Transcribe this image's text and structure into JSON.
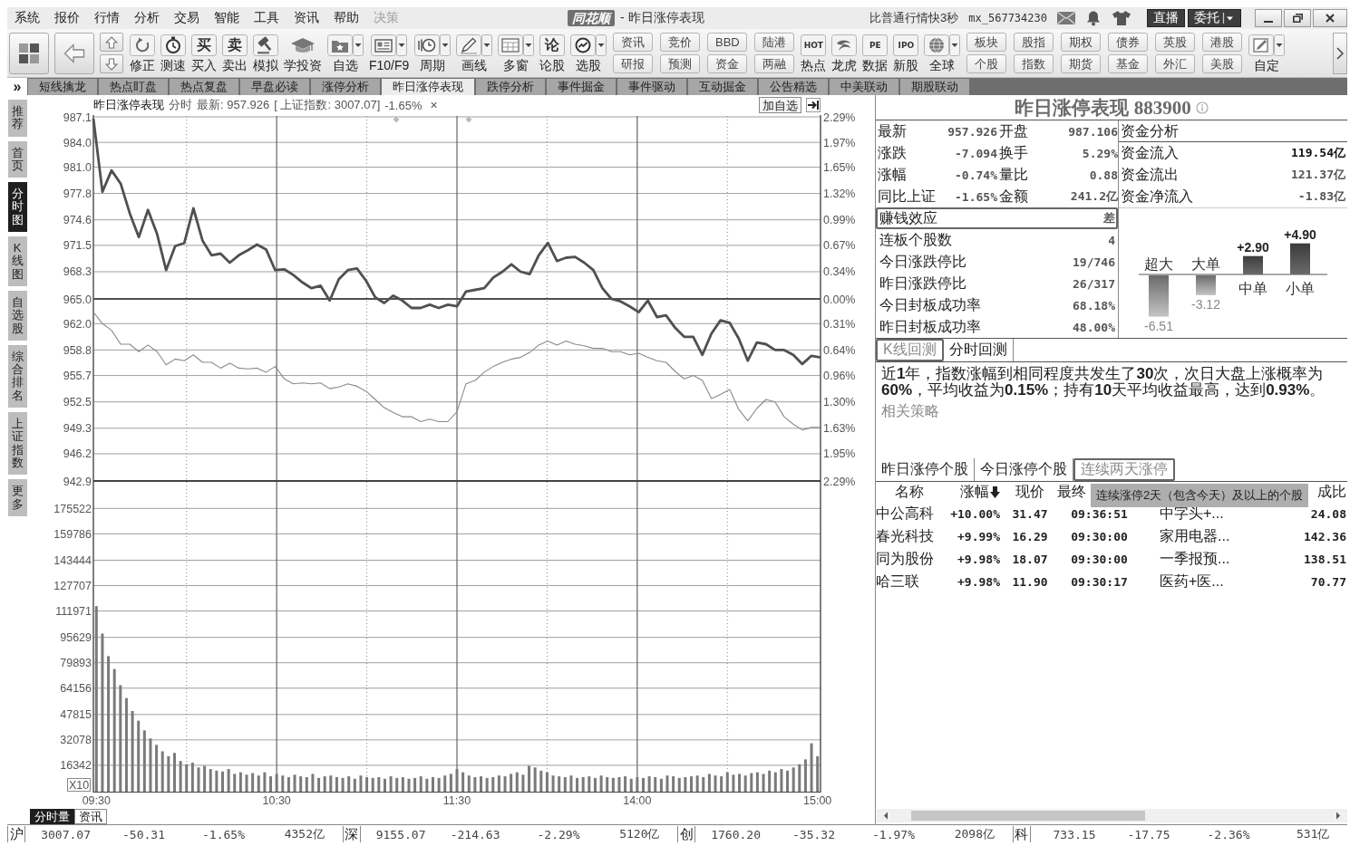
{
  "menu_bar": {
    "items": [
      {
        "label": "系统",
        "disabled": false
      },
      {
        "label": "报价",
        "disabled": false
      },
      {
        "label": "行情",
        "disabled": false
      },
      {
        "label": "分析",
        "disabled": false
      },
      {
        "label": "交易",
        "disabled": false
      },
      {
        "label": "智能",
        "disabled": false
      },
      {
        "label": "工具",
        "disabled": false
      },
      {
        "label": "资讯",
        "disabled": false
      },
      {
        "label": "帮助",
        "disabled": false
      },
      {
        "label": "决策",
        "disabled": true
      }
    ],
    "logo": "同花顺",
    "title": "- 昨日涨停表现",
    "speed_note": "比普通行情快3秒",
    "user": "mx_567734230",
    "buttons": [
      {
        "label": "直播",
        "dropdown": false
      },
      {
        "label": "委托",
        "dropdown": true
      }
    ]
  },
  "toolbar": {
    "tools": [
      {
        "label": "修正",
        "dropdown": false
      },
      {
        "label": "测速",
        "dropdown": false
      },
      {
        "label": "买入",
        "glyph": "买",
        "dropdown": false
      },
      {
        "label": "卖出",
        "glyph": "卖",
        "dropdown": false
      },
      {
        "label": "模拟",
        "dropdown": false
      },
      {
        "label": "学投资",
        "dropdown": false
      },
      {
        "label": "自选",
        "dropdown": true
      },
      {
        "label": "F10/F9",
        "dropdown": true
      },
      {
        "label": "周期",
        "dropdown": true
      },
      {
        "label": "画线",
        "dropdown": true
      },
      {
        "label": "多窗",
        "dropdown": true
      },
      {
        "label": "论股",
        "glyph": "论",
        "dropdown": false
      },
      {
        "label": "选股",
        "dropdown": true
      }
    ],
    "pairs": [
      [
        "资讯",
        "研报"
      ],
      [
        "竞价",
        "预测"
      ],
      [
        "BBD",
        "资金"
      ],
      [
        "陆港",
        "两融"
      ]
    ],
    "tools_2": [
      {
        "label": "热点",
        "glyph": "HOT",
        "dropdown": false
      },
      {
        "label": "龙虎",
        "dropdown": false
      },
      {
        "label": "数据",
        "glyph": "PE",
        "dropdown": false
      },
      {
        "label": "新股",
        "glyph": "IPO",
        "dropdown": false
      },
      {
        "label": "全球",
        "dropdown": true
      }
    ],
    "pairs_2": [
      [
        "板块",
        "个股"
      ],
      [
        "股指",
        "指数"
      ],
      [
        "期权",
        "期货"
      ],
      [
        "债券",
        "基金"
      ],
      [
        "英股",
        "外汇"
      ],
      [
        "港股",
        "美股"
      ]
    ],
    "custom": {
      "label": "自定",
      "dropdown": true
    }
  },
  "tabs": [
    {
      "label": "短线擒龙",
      "selected": false
    },
    {
      "label": "热点盯盘",
      "selected": false
    },
    {
      "label": "热点复盘",
      "selected": false
    },
    {
      "label": "早盘必读",
      "selected": false
    },
    {
      "label": "涨停分析",
      "selected": false
    },
    {
      "label": "昨日涨停表现",
      "selected": true
    },
    {
      "label": "跌停分析",
      "selected": false
    },
    {
      "label": "事件掘金",
      "selected": false
    },
    {
      "label": "事件驱动",
      "selected": false
    },
    {
      "label": "互动掘金",
      "selected": false
    },
    {
      "label": "公告精选",
      "selected": false
    },
    {
      "label": "中美联动",
      "selected": false
    },
    {
      "label": "期股联动",
      "selected": false
    }
  ],
  "side_tabs": {
    "expand": "»",
    "items": [
      {
        "label": "推荐",
        "selected": false
      },
      {
        "label": "首页",
        "selected": false
      },
      {
        "label": "分时图",
        "selected": true
      },
      {
        "label": "K线图",
        "selected": false
      },
      {
        "label": "自选股",
        "selected": false
      },
      {
        "label": "综合排名",
        "selected": false
      },
      {
        "label": "上证指数",
        "selected": false
      },
      {
        "label": "更多",
        "selected": false
      }
    ]
  },
  "chart": {
    "header": {
      "mode": "分时",
      "latest": "最新: 957.926",
      "index": "[ 上证指数: 3007.07]",
      "change": "-1.65%",
      "close": "×"
    },
    "add_button": "加自选",
    "price": {
      "pct_labels": [
        "2.29%",
        "1.97%",
        "1.65%",
        "1.32%",
        "0.99%",
        "0.67%",
        "0.34%",
        "0.00%",
        "0.31%",
        "0.64%",
        "0.96%",
        "1.30%",
        "1.63%",
        "1.95%",
        "2.29%"
      ],
      "chart_data": {
        "type": "line",
        "title": "昨日涨停表现",
        "grid": true,
        "ylim": [
          942.9,
          987.1
        ],
        "yticks": [
          {
            "value": 987.1,
            "label": "987.1"
          },
          {
            "value": 984.0,
            "label": "984.0"
          },
          {
            "value": 981.0,
            "label": "981.0"
          },
          {
            "value": 977.8,
            "label": "977.8"
          },
          {
            "value": 974.6,
            "label": "974.6"
          },
          {
            "value": 971.5,
            "label": "971.5"
          },
          {
            "value": 968.3,
            "label": "968.3"
          },
          {
            "value": 965.0,
            "label": "965.0"
          },
          {
            "value": 962.0,
            "label": "962.0"
          },
          {
            "value": 958.8,
            "label": "958.8"
          },
          {
            "value": 955.7,
            "label": "955.7"
          },
          {
            "value": 952.5,
            "label": "952.5"
          },
          {
            "value": 949.3,
            "label": "949.3"
          },
          {
            "value": 946.2,
            "label": "946.2"
          },
          {
            "value": 942.9,
            "label": "942.9"
          }
        ],
        "ref_lines": [
          {
            "axis": "y",
            "value": 965.0
          }
        ],
        "series": [
          {
            "color": "#505050",
            "values": [
              986.9,
              978.0,
              980.6,
              979.0,
              975.4,
              972.5,
              975.8,
              972.9,
              968.5,
              971.4,
              971.8,
              976.0,
              972.1,
              970.3,
              970.5,
              969.4,
              970.3,
              970.9,
              971.6,
              971.0,
              968.5,
              968.6,
              967.9,
              967.0,
              966.3,
              966.6,
              964.8,
              967.4,
              968.5,
              968.7,
              967.2,
              965.2,
              964.5,
              965.4,
              964.8,
              963.9,
              963.9,
              964.3,
              963.9,
              964.3,
              964.1,
              965.9,
              966.1,
              966.3,
              967.6,
              968.3,
              969.2,
              968.3,
              968.0,
              970.3,
              971.8,
              969.6,
              970.0,
              970.1,
              969.4,
              968.5,
              966.3,
              965.0,
              964.7,
              964.1,
              963.4,
              964.8,
              962.8,
              963.0,
              961.5,
              960.4,
              960.4,
              958.2,
              960.8,
              962.4,
              962.1,
              960.2,
              957.5,
              959.7,
              959.5,
              958.8,
              958.8,
              958.2,
              957.1,
              958.1,
              957.9
            ]
          },
          {
            "color": "#8a8a8a",
            "values": [
              963.4,
              962.0,
              961.2,
              959.5,
              959.5,
              958.6,
              959.4,
              958.6,
              957.0,
              957.7,
              957.5,
              958.2,
              957.3,
              957.3,
              956.6,
              957.2,
              956.6,
              956.5,
              956.6,
              956.1,
              956.8,
              955.3,
              954.7,
              954.8,
              954.7,
              954.8,
              954.1,
              954.3,
              954.7,
              954.4,
              953.8,
              952.8,
              951.8,
              951.2,
              950.7,
              950.7,
              950.1,
              950.4,
              950.1,
              950.1,
              951.3,
              954.7,
              955.1,
              956.1,
              956.8,
              957.3,
              957.7,
              957.9,
              958.5,
              959.4,
              959.9,
              959.4,
              959.9,
              959.5,
              959.3,
              959.0,
              959.0,
              958.6,
              958.6,
              958.2,
              958.4,
              957.9,
              957.5,
              957.3,
              956.2,
              955.3,
              955.7,
              955.1,
              952.9,
              953.4,
              954.0,
              951.6,
              950.2,
              951.7,
              952.8,
              952.5,
              950.7,
              949.8,
              949.1,
              949.4,
              949.4
            ]
          }
        ]
      }
    },
    "volume": {
      "unit": "X10",
      "chart_data": {
        "type": "bar",
        "grid": true,
        "ylim": [
          0,
          192000
        ],
        "yticks": [
          175522,
          159786,
          143444,
          127707,
          111971,
          95629,
          79893,
          64156,
          47815,
          32078,
          16342
        ],
        "categories": [
          "09:30",
          null,
          null,
          null,
          null,
          null,
          null,
          null,
          null,
          null,
          null,
          null,
          null,
          null,
          null,
          null,
          null,
          null,
          null,
          null,
          null,
          null,
          null,
          null,
          null,
          null,
          null,
          null,
          null,
          null,
          "10:30",
          null,
          null,
          null,
          null,
          null,
          null,
          null,
          null,
          null,
          null,
          null,
          null,
          null,
          null,
          null,
          null,
          null,
          null,
          null,
          null,
          null,
          null,
          null,
          null,
          null,
          null,
          null,
          null,
          null,
          "11:30",
          null,
          null,
          null,
          null,
          null,
          null,
          null,
          null,
          null,
          null,
          null,
          null,
          null,
          null,
          null,
          null,
          null,
          null,
          null,
          null,
          null,
          null,
          null,
          null,
          null,
          null,
          null,
          null,
          null,
          "14:00",
          null,
          null,
          null,
          null,
          null,
          null,
          null,
          null,
          null,
          null,
          null,
          null,
          null,
          null,
          null,
          null,
          null,
          null,
          null,
          null,
          null,
          null,
          null,
          null,
          null,
          null,
          null,
          null,
          null,
          "15:00"
        ],
        "values": [
          115000,
          98000,
          84000,
          76000,
          66000,
          58000,
          50000,
          44000,
          38000,
          33000,
          29000,
          25000,
          22000,
          24000,
          19000,
          17000,
          18000,
          15000,
          16000,
          14000,
          13000,
          12500,
          14000,
          11000,
          12000,
          10500,
          11500,
          10000,
          12000,
          9500,
          11000,
          10000,
          9000,
          10500,
          9500,
          9000,
          11000,
          8500,
          9500,
          10000,
          9000,
          8500,
          9500,
          8000,
          10000,
          9000,
          8500,
          9000,
          8000,
          9500,
          8500,
          9000,
          8000,
          8500,
          9500,
          8000,
          9000,
          8500,
          10000,
          11000,
          14000,
          12000,
          10000,
          9000,
          9500,
          8500,
          9000,
          10000,
          9500,
          11000,
          12000,
          10500,
          16000,
          15000,
          13000,
          12000,
          10000,
          9500,
          9000,
          10000,
          8500,
          9000,
          9500,
          8500,
          10000,
          9000,
          8500,
          9000,
          9500,
          8000,
          9000,
          8500,
          9500,
          9000,
          8000,
          10000,
          9500,
          8500,
          9000,
          9500,
          10000,
          9000,
          11000,
          10000,
          9500,
          12000,
          10500,
          11000,
          10000,
          11500,
          12000,
          11000,
          13000,
          12000,
          14000,
          13000,
          15000,
          17000,
          20000,
          30000,
          22000
        ]
      }
    },
    "bottom_tabs": [
      {
        "label": "分时量",
        "selected": true
      },
      {
        "label": "资讯",
        "selected": false
      }
    ]
  },
  "quote": {
    "title": "昨日涨停表现 883900",
    "rows": [
      [
        {
          "label": "最新",
          "value": "957.926"
        },
        {
          "label": "开盘",
          "value": "987.106"
        }
      ],
      [
        {
          "label": "涨跌",
          "value": "-7.094"
        },
        {
          "label": "换手",
          "value": "5.29%"
        }
      ],
      [
        {
          "label": "涨幅",
          "value": "-0.74%"
        },
        {
          "label": "量比",
          "value": "0.88"
        }
      ],
      [
        {
          "label": "同比上证",
          "value": "-1.65%"
        },
        {
          "label": "金额",
          "value": "241.2亿"
        }
      ]
    ],
    "stats": [
      {
        "label": "赚钱效应",
        "value": "差",
        "selected": true
      },
      {
        "label": "连板个股数",
        "value": "4",
        "selected": false
      },
      {
        "label": "今日涨跌停比",
        "value": "19/746",
        "selected": false
      },
      {
        "label": "昨日涨跌停比",
        "value": "26/317",
        "selected": false
      },
      {
        "label": "今日封板成功率",
        "value": "68.18%",
        "selected": false
      },
      {
        "label": "昨日封板成功率",
        "value": "48.00%",
        "selected": false
      }
    ]
  },
  "fund_flow": {
    "title": "资金分析",
    "rows": [
      {
        "label": "资金流入",
        "value": "119.54亿",
        "bold": true
      },
      {
        "label": "资金流出",
        "value": "121.37亿",
        "bold": false
      },
      {
        "label": "资金净流入",
        "value": "-1.83亿",
        "bold": false
      }
    ],
    "chart_data": {
      "type": "bar",
      "categories": [
        "超大",
        "大单",
        "中单",
        "小单"
      ],
      "values": [
        -6.51,
        -3.12,
        2.9,
        4.9
      ],
      "value_labels": [
        "-6.51",
        "-3.12",
        "+2.90",
        "+4.90"
      ]
    }
  },
  "backtest": {
    "tabs": [
      {
        "label": "K线回测",
        "selected": true
      },
      {
        "label": "分时回测",
        "selected": false
      }
    ],
    "text": "近**1**年，指数涨幅到相同程度共发生了**30**次，次日大盘上涨概率为**60%**，平均收益为**0.15%**；持有**10**天平均收益最高，达到**0.93%**。",
    "link": "相关策略"
  },
  "limit_up": {
    "tabs": [
      {
        "label": "昨日涨停个股",
        "selected": false
      },
      {
        "label": "今日涨停个股",
        "selected": false
      },
      {
        "label": "连续两天涨停",
        "selected": true
      }
    ],
    "tooltip": "连续涨停2天（包含今天）及以上的个股",
    "columns": [
      {
        "label": "名称",
        "sorted": false
      },
      {
        "label": "涨幅",
        "sorted": true
      },
      {
        "label": "现价",
        "sorted": false
      },
      {
        "label": "最终",
        "sorted": false
      },
      {},
      {
        "label": "成比",
        "sorted": false
      }
    ],
    "rows": [
      [
        "中公高科",
        "+10.00%",
        "31.47",
        "09:36:51",
        "中字头+...",
        "24.08"
      ],
      [
        "春光科技",
        "+9.99%",
        "16.29",
        "09:30:00",
        "家用电器...",
        "142.36"
      ],
      [
        "同为股份",
        "+9.98%",
        "18.07",
        "09:30:00",
        "一季报预...",
        "138.51"
      ],
      [
        "哈三联",
        "+9.98%",
        "11.90",
        "09:30:17",
        "医药+医...",
        "70.77"
      ]
    ]
  },
  "status_bar": [
    {
      "market": "沪",
      "values": [
        "3007.07",
        "-50.31",
        "-1.65%",
        "4352亿"
      ]
    },
    {
      "market": "深",
      "values": [
        "9155.07",
        "-214.63",
        "-2.29%",
        "5120亿"
      ]
    },
    {
      "market": "创",
      "values": [
        "1760.20",
        "-35.32",
        "-1.97%",
        "2098亿"
      ]
    },
    {
      "market": "科",
      "values": [
        "733.15",
        "-17.75",
        "-2.36%",
        "531亿"
      ]
    }
  ]
}
